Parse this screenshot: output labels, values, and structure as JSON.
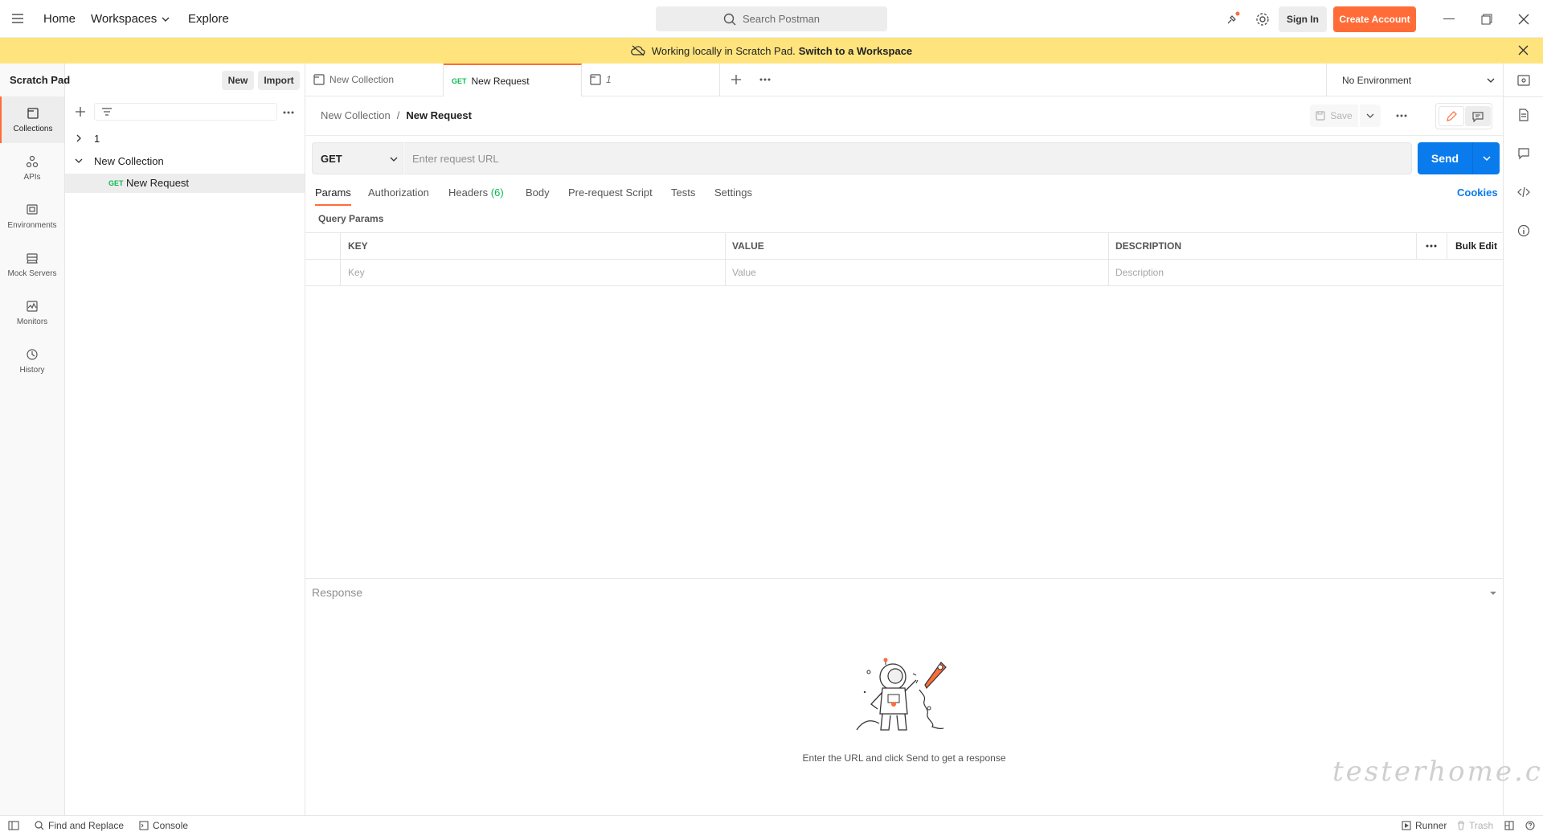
{
  "header": {
    "nav": [
      "Home",
      "Workspaces",
      "Explore"
    ],
    "search_placeholder": "Search Postman",
    "sign_in": "Sign In",
    "create_account": "Create Account"
  },
  "banner": {
    "text": "Working locally in Scratch Pad.",
    "link": "Switch to a Workspace"
  },
  "sidebar": {
    "title": "Scratch Pad",
    "new_label": "New",
    "import_label": "Import",
    "rail": [
      "Collections",
      "APIs",
      "Environments",
      "Mock Servers",
      "Monitors",
      "History"
    ],
    "tree": {
      "item1": "1",
      "collection": "New Collection",
      "request_method": "GET",
      "request_name": "New Request"
    }
  },
  "tabs": [
    {
      "label": "New Collection"
    },
    {
      "method": "GET",
      "label": "New Request"
    },
    {
      "label": "1"
    }
  ],
  "environment": "No Environment",
  "request": {
    "breadcrumb_collection": "New Collection",
    "breadcrumb_sep": "/",
    "breadcrumb_request": "New Request",
    "save_label": "Save",
    "method": "GET",
    "url_placeholder": "Enter request URL",
    "send_label": "Send",
    "tabs": [
      "Params",
      "Authorization",
      "Headers",
      "Body",
      "Pre-request Script",
      "Tests",
      "Settings"
    ],
    "headers_count": "(6)",
    "cookies": "Cookies"
  },
  "params": {
    "section_title": "Query Params",
    "columns": [
      "KEY",
      "VALUE",
      "DESCRIPTION"
    ],
    "bulk_edit": "Bulk Edit",
    "row_placeholders": [
      "Key",
      "Value",
      "Description"
    ]
  },
  "response": {
    "title": "Response",
    "empty_text": "Enter the URL and click Send to get a response"
  },
  "footer": {
    "find_replace": "Find and Replace",
    "console": "Console",
    "runner": "Runner",
    "trash": "Trash"
  },
  "watermark": "testerhome.com",
  "colors": {
    "accent": "#ff6c37",
    "send": "#097bed",
    "banner": "#ffe47e",
    "get_method": "#0cbb52"
  }
}
